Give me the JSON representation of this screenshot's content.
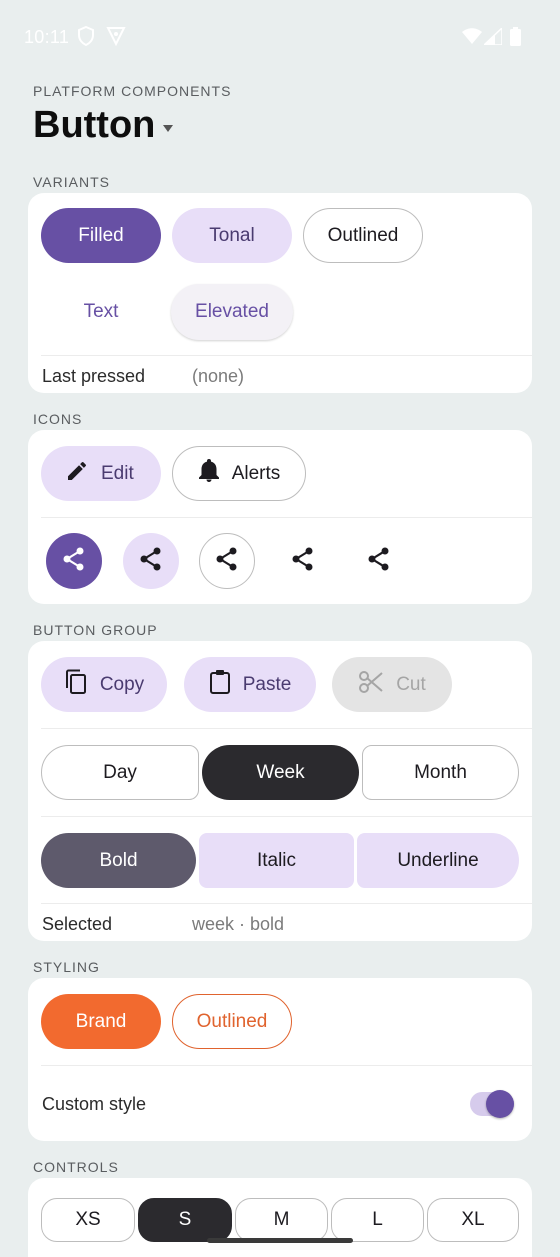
{
  "status_bar": {
    "time": "10:11"
  },
  "header": {
    "eyebrow": "PLATFORM COMPONENTS",
    "title": "Button"
  },
  "sections": {
    "variants": "VARIANTS",
    "icons": "ICONS",
    "button_group": "BUTTON GROUP",
    "styling": "STYLING",
    "controls": "CONTROLS"
  },
  "variants": {
    "filled": "Filled",
    "tonal": "Tonal",
    "outlined": "Outlined",
    "text": "Text",
    "elevated": "Elevated",
    "last_pressed_label": "Last pressed",
    "last_pressed_value": "(none)"
  },
  "icons": {
    "edit": "Edit",
    "alerts": "Alerts"
  },
  "button_group": {
    "copy": "Copy",
    "paste": "Paste",
    "cut": "Cut",
    "day": "Day",
    "week": "Week",
    "month": "Month",
    "bold": "Bold",
    "italic": "Italic",
    "underline": "Underline",
    "selected_label": "Selected",
    "selected_value": "week · bold"
  },
  "styling": {
    "brand": "Brand",
    "outlined": "Outlined",
    "custom_style_label": "Custom style",
    "custom_style_on": true
  },
  "controls": {
    "sizes": [
      "XS",
      "S",
      "M",
      "L",
      "XL"
    ],
    "selected": "S"
  },
  "colors": {
    "primary": "#6750a4",
    "tonal": "#e8def8",
    "brand": "#f26a2f",
    "selected_dark": "#2b2a2e",
    "bold_selected": "#5e5a6c"
  }
}
